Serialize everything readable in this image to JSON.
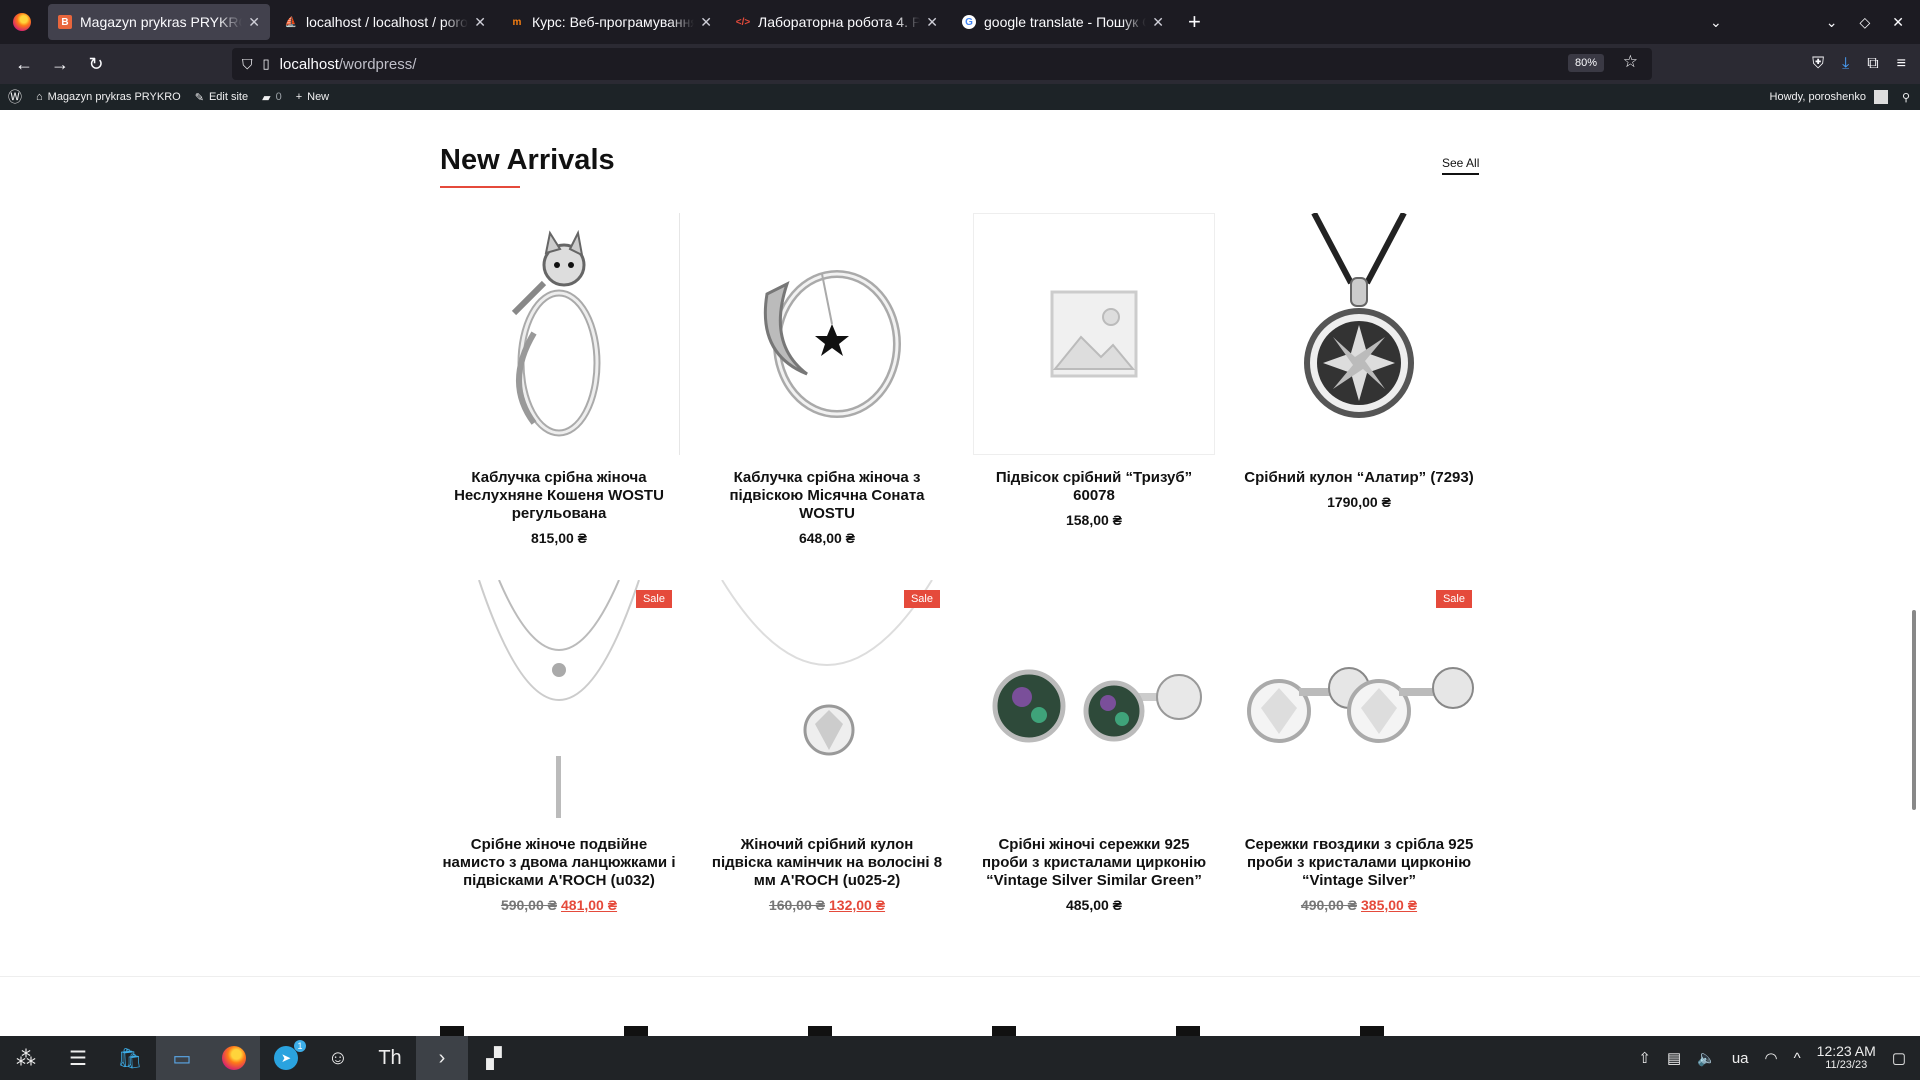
{
  "browser": {
    "tabs": [
      {
        "title": "Magazyn prykras PRYKRO",
        "active": true,
        "favicon": "site-icon"
      },
      {
        "title": "localhost / localhost / poro",
        "active": false,
        "favicon": "phpmyadmin-icon"
      },
      {
        "title": "Курс: Веб-програмування",
        "active": false,
        "favicon": "moodle-icon"
      },
      {
        "title": "Лабораторна робота 4. Р",
        "active": false,
        "favicon": "code-icon"
      },
      {
        "title": "google translate - Пошук G",
        "active": false,
        "favicon": "google-icon"
      }
    ],
    "url_host": "localhost",
    "url_path": "/wordpress/",
    "zoom": "80%"
  },
  "wp_admin_bar": {
    "site_name": "Magazyn prykras PRYKRO",
    "edit_site": "Edit site",
    "comments_count": "0",
    "new_label": "New",
    "howdy": "Howdy, poroshenko"
  },
  "section": {
    "title": "New Arrivals",
    "see_all": "See All",
    "accent": "#e54a3b"
  },
  "products": [
    {
      "title": "Каблучка срібна жіноча Неслухняне Кошеня WOSTU регульована",
      "price": "815,00 ₴",
      "sale": false,
      "image": "cat-ring"
    },
    {
      "title": "Каблучка срібна жіноча з підвіскою Місячна Соната WOSTU",
      "price": "648,00 ₴",
      "sale": false,
      "image": "moon-ring"
    },
    {
      "title": "Підвісок срібний “Тризуб” 60078",
      "price": "158,00 ₴",
      "sale": false,
      "image": "placeholder"
    },
    {
      "title": "Срібний кулон “Алатир” (7293)",
      "price": "1790,00 ₴",
      "sale": false,
      "image": "alatyr-pendant"
    },
    {
      "title": "Срібне жіноче подвійне намисто з двома ланцюжками і підвісками A'ROCH (u032)",
      "old_price": "590,00 ₴",
      "price": "481,00 ₴",
      "sale": true,
      "sale_label": "Sale",
      "image": "double-necklace"
    },
    {
      "title": "Жіночий срібний кулон підвіска камінчик на волосіні 8 мм A'ROCH (u025-2)",
      "old_price": "160,00 ₴",
      "price": "132,00 ₴",
      "sale": true,
      "sale_label": "Sale",
      "image": "crystal-pendant"
    },
    {
      "title": "Срібні жіночі сережки 925 проби з кристалами цирконію “Vintage Silver Similar Green”",
      "price": "485,00 ₴",
      "sale": false,
      "image": "green-earrings"
    },
    {
      "title": "Сережки гвоздики з срібла 925 проби з кристалами цирконію “Vintage Silver”",
      "old_price": "490,00 ₴",
      "price": "385,00 ₴",
      "sale": true,
      "sale_label": "Sale",
      "image": "silver-earrings"
    }
  ],
  "taskbar": {
    "keyboard_layout": "ua",
    "time": "12:23 AM",
    "date": "11/23/23",
    "telegram_badge": "1"
  }
}
